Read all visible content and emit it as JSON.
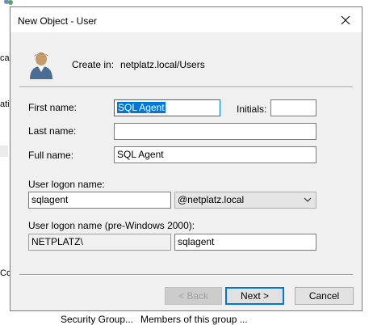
{
  "background": {
    "fragments": [
      "ca",
      "ati",
      "Co"
    ],
    "bottom_labels": [
      "Security Group...",
      "Members of this group ..."
    ]
  },
  "dialog": {
    "title": "New Object - User",
    "create_in_label": "Create in:",
    "create_in_path": "netplatz.local/Users",
    "fields": {
      "first_name_label": "First name:",
      "first_name_value": "SQL Agent",
      "initials_label": "Initials:",
      "initials_value": "",
      "last_name_label": "Last name:",
      "last_name_value": "",
      "full_name_label": "Full name:",
      "full_name_value": "SQL Agent",
      "logon_name_label": "User logon name:",
      "logon_name_value": "sqlagent",
      "domain_suffix": "@netplatz.local",
      "pre2000_label": "User logon name (pre-Windows 2000):",
      "pre2000_domain": "NETPLATZ\\",
      "pre2000_name": "sqlagent"
    },
    "buttons": {
      "back": "< Back",
      "next": "Next >",
      "cancel": "Cancel"
    }
  },
  "icons": {
    "close": "close-icon",
    "user": "user-icon",
    "dropdown": "chevron-down-icon"
  },
  "colors": {
    "dialog_bg": "#f0f0f0",
    "focus": "#0078d7",
    "selection": "#0078d7"
  }
}
